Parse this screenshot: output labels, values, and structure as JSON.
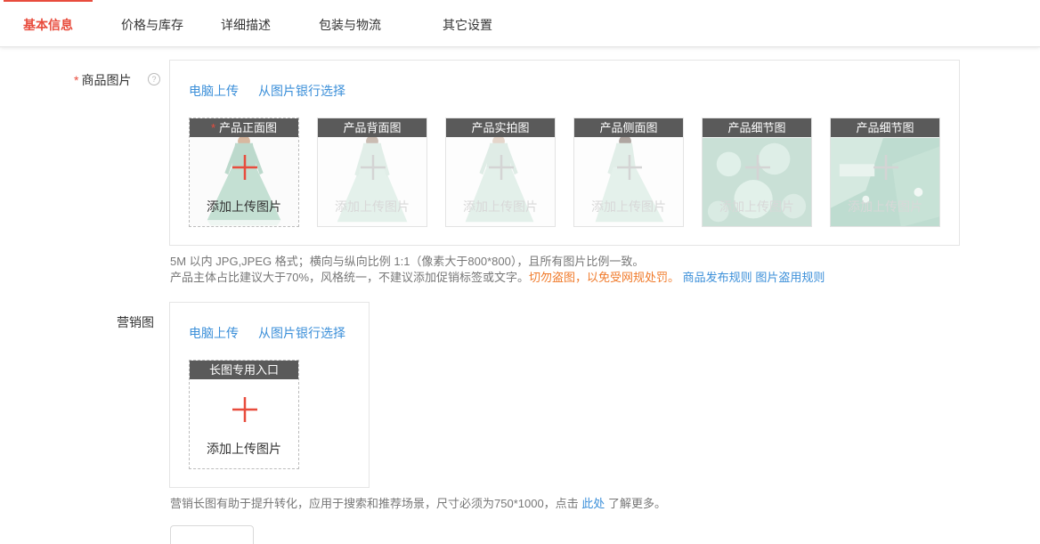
{
  "tabs": [
    {
      "label": "基本信息",
      "active": true
    },
    {
      "label": "价格与库存",
      "active": false
    },
    {
      "label": "详细描述",
      "active": false
    },
    {
      "label": "包装与物流",
      "active": false
    },
    {
      "label": "其它设置",
      "active": false
    }
  ],
  "product_images": {
    "label": "商品图片",
    "required_mark": "*",
    "help_icon": "?",
    "upload_from_computer": "电脑上传",
    "select_from_bank": "从图片银行选择",
    "required_star": "*",
    "slots": [
      {
        "title": "产品正面图",
        "required": true,
        "text": "添加上传图片",
        "icon": "plus-icon"
      },
      {
        "title": "产品背面图",
        "required": false,
        "text": "添加上传图片",
        "icon": "plus-icon"
      },
      {
        "title": "产品实拍图",
        "required": false,
        "text": "添加上传图片",
        "icon": "plus-icon"
      },
      {
        "title": "产品侧面图",
        "required": false,
        "text": "添加上传图片",
        "icon": "plus-icon"
      },
      {
        "title": "产品细节图",
        "required": false,
        "text": "添加上传图片",
        "icon": "plus-icon"
      },
      {
        "title": "产品细节图",
        "required": false,
        "text": "添加上传图片",
        "icon": "plus-icon"
      }
    ],
    "note_line1": "5M 以内 JPG,JPEG 格式；横向与纵向比例 1:1（像素大于800*800），且所有图片比例一致。",
    "note_line2_prefix": "产品主体占比建议大于70%，风格统一，不建议添加促销标签或文字。",
    "note_line2_warning": "切勿盗图，以免受网规处罚。",
    "rule_link_1": "商品发布规则",
    "rule_link_2": "图片盗用规则"
  },
  "marketing_image": {
    "label": "营销图",
    "upload_from_computer": "电脑上传",
    "select_from_bank": "从图片银行选择",
    "slot_title": "长图专用入口",
    "slot_text": "添加上传图片",
    "note_prefix": "营销长图有助于提升转化，应用于搜索和推荐场景，尺寸必须为750*1000，点击",
    "note_link": "此处",
    "note_suffix": "了解更多。"
  },
  "colors": {
    "accent": "#e84c3d",
    "link": "#3b8fd9",
    "warning": "#f07a2a",
    "slot_header": "#5a5a5a"
  }
}
